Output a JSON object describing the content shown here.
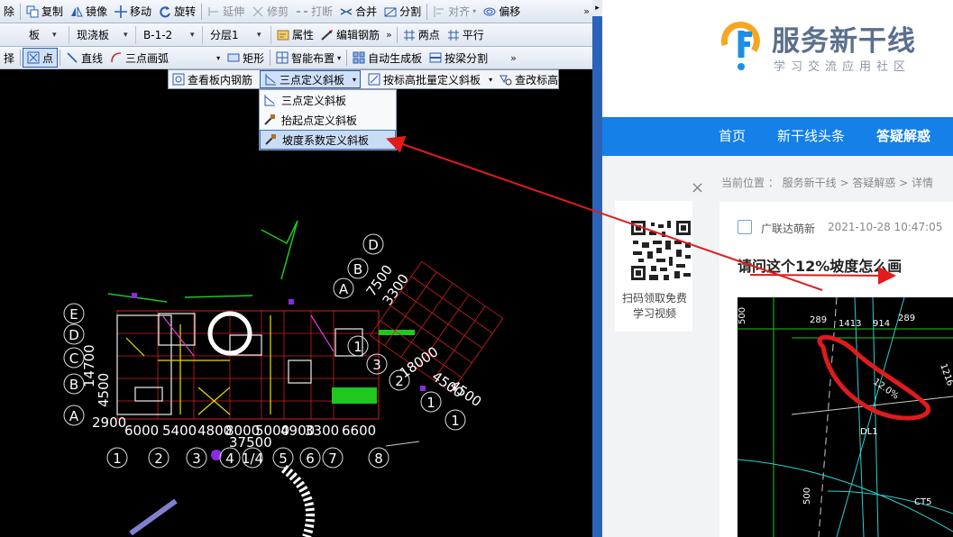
{
  "cad": {
    "toolbar1": {
      "items": [
        {
          "label": "除",
          "icon": "delete-icon"
        },
        {
          "label": "复制",
          "icon": "copy-icon"
        },
        {
          "label": "镜像",
          "icon": "mirror-icon"
        },
        {
          "label": "移动",
          "icon": "move-icon"
        },
        {
          "label": "旋转",
          "icon": "rotate-icon"
        },
        {
          "label": "延伸",
          "icon": "extend-icon"
        },
        {
          "label": "修剪",
          "icon": "trim-icon"
        },
        {
          "label": "打断",
          "icon": "break-icon"
        },
        {
          "label": "合并",
          "icon": "merge-icon"
        },
        {
          "label": "分割",
          "icon": "split-icon"
        },
        {
          "label": "对齐",
          "icon": "align-icon"
        },
        {
          "label": "偏移",
          "icon": "offset-icon"
        }
      ]
    },
    "toolbar2": {
      "combo_type": "板",
      "combo_kind": "现浇板",
      "combo_name": "B-1-2",
      "combo_layer": "分层1",
      "properties": "属性",
      "edit_rebar": "编辑钢筋",
      "two_point": "两点",
      "parallel": "平行"
    },
    "toolbar3": {
      "select": "择",
      "point": "点",
      "line": "直线",
      "arc": "三点画弧",
      "rect": "矩形",
      "smart_layout": "智能布置",
      "auto_gen": "自动生成板",
      "split_by_beam": "按梁分割"
    },
    "submenu_bar": {
      "view_rebar": "查看板内钢筋",
      "three_point_slope": "三点定义斜板",
      "batch_slope": "按标高批量定义斜板",
      "check_elevation": "查改标高"
    },
    "slope_menu": {
      "items": [
        "三点定义斜板",
        "抬起点定义斜板",
        "坡度系数定义斜板"
      ],
      "selected": "坡度系数定义斜板"
    },
    "drawing": {
      "axis_left": [
        "E",
        "D",
        "C",
        "B",
        "A"
      ],
      "axis_bottom": [
        "1",
        "2",
        "3",
        "4",
        "1/4",
        "5",
        "6",
        "7",
        "8"
      ],
      "axis_rot": [
        "A",
        "B",
        "D",
        "1",
        "2",
        "1",
        "3"
      ],
      "dims_bottom": [
        "6000",
        "5400",
        "4800",
        "8000",
        "5000",
        "4900",
        "3300",
        "6600"
      ],
      "dim_total": "37500",
      "dim_2900": "2900",
      "dim_left_vertical": "14700",
      "dim_left_parts": "4500",
      "dims_rot": [
        "18000",
        "4500",
        "4500",
        "7500",
        "3300"
      ]
    }
  },
  "web": {
    "logo_name": "服务新干线",
    "logo_slogan": "学习交流应用社区",
    "nav": [
      "首页",
      "新干线头条",
      "答疑解惑"
    ],
    "nav_active": "答疑解惑",
    "qr_text": "扫码领取免费学习视频",
    "close": "×",
    "breadcrumb": "当前位置 ： 服务新干线 > 答疑解惑 > 详情",
    "author": "广联达萌新",
    "time": "2021-10-28 10:47:05",
    "title": "请问这个12%坡度怎么画",
    "image_labels": [
      "500",
      "289",
      "1413",
      "914",
      "289",
      "12.0%",
      "DL1",
      "CT5",
      "1216",
      "500"
    ]
  },
  "colors": {
    "annotation_red": "#e31b1b",
    "nav_blue": "#1480e8",
    "menu_selected": "#c9dcf5"
  }
}
